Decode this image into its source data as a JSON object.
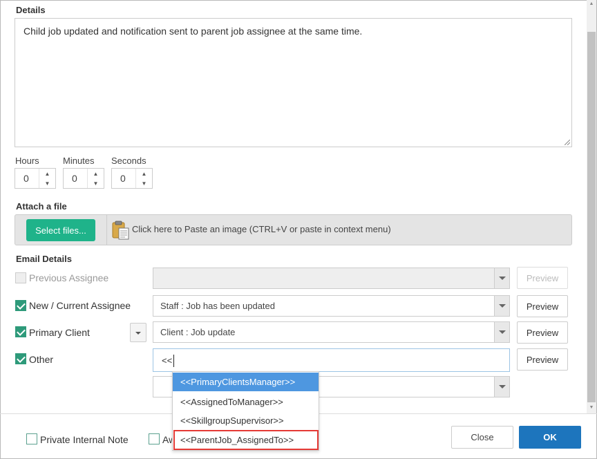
{
  "details": {
    "label": "Details",
    "text": "Child job updated and notification sent to parent job assignee at the same time."
  },
  "time": {
    "hours": {
      "label": "Hours",
      "value": "0"
    },
    "minutes": {
      "label": "Minutes",
      "value": "0"
    },
    "seconds": {
      "label": "Seconds",
      "value": "0"
    }
  },
  "attach": {
    "label": "Attach a file",
    "select_button": "Select files...",
    "paste_text": "Click here to Paste an image (CTRL+V or paste in context menu)"
  },
  "email": {
    "label": "Email Details",
    "rows": [
      {
        "label": "Previous Assignee",
        "checked": false,
        "enabled": false,
        "select_value": "",
        "preview": "Preview"
      },
      {
        "label": "New / Current Assignee",
        "checked": true,
        "enabled": true,
        "select_value": "Staff : Job has been updated",
        "preview": "Preview"
      },
      {
        "label": "Primary Client",
        "checked": true,
        "enabled": true,
        "select_value": "Client : Job update",
        "preview": "Preview"
      },
      {
        "label": "Other",
        "checked": true,
        "enabled": true,
        "input_value": "<<",
        "preview": "Preview"
      }
    ]
  },
  "autocomplete": {
    "items": [
      "<<PrimaryClientsManager>>",
      "<<AssignedToManager>>",
      "<<SkillgroupSupervisor>>",
      "<<ParentJob_AssignedTo>>"
    ],
    "selected_index": 0,
    "highlighted_index": 3
  },
  "footer": {
    "private_note_label": "Private Internal Note",
    "second_checkbox_label": "Aw",
    "close_label": "Close",
    "ok_label": "OK"
  },
  "colors": {
    "accent_green": "#1fb38a",
    "primary_blue": "#1d75bd",
    "selection_blue": "#4e97e0",
    "highlight_red": "#e53935"
  }
}
